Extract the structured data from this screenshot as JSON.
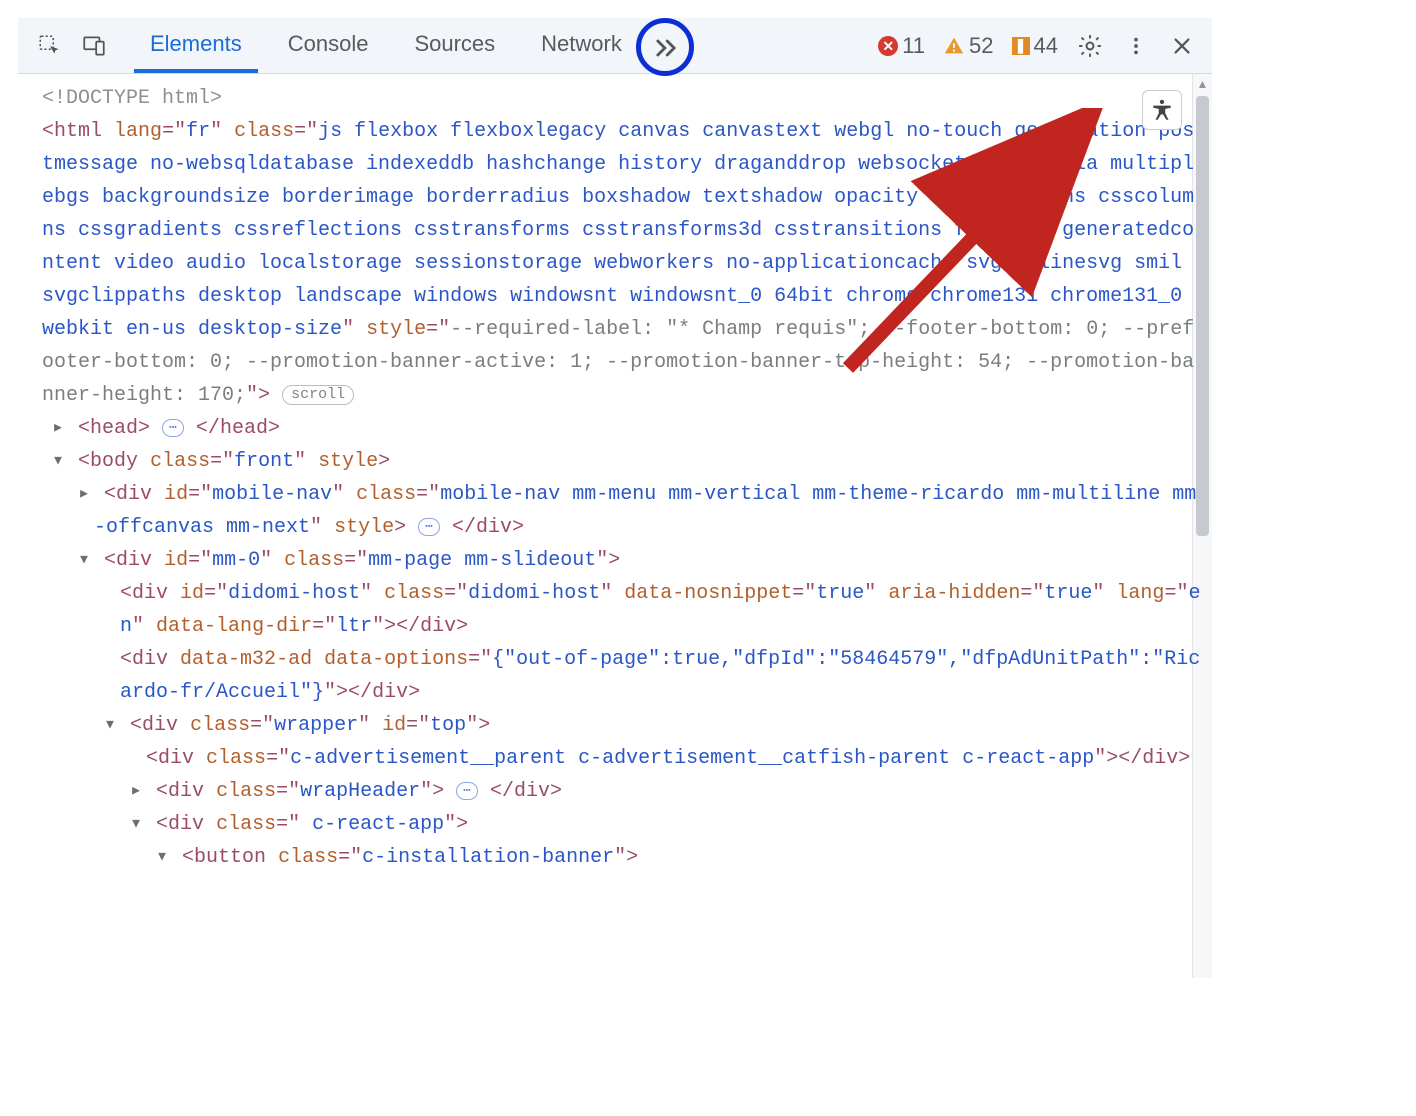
{
  "tabs": {
    "elements": "Elements",
    "console": "Console",
    "sources": "Sources",
    "network": "Network"
  },
  "issues": {
    "errors": "11",
    "warnings": "52",
    "info": "44"
  },
  "dom": {
    "doctype": "<!DOCTYPE html>",
    "html_open_1": "<html lang=\"fr\" class=\"js flexbox flexboxlegacy canvas canvastext webgl no-touch geolocation postmessage no-websqldatabase indexeddb hashchange history draganddrop websockets rgba hsla multiplebgs backgroundsize borderimage borderradius boxshadow textshadow opacity cssanimations csscolumns cssgradients cssreflections csstransforms csstransforms3d csstransitions fontface generatedcontent video audio localstorage sessionstorage webworkers no-applicationcache svg inlinesvg smil svgclippaths desktop landscape windows windowsnt windowsnt_0 64bit chrome chrome131 chrome131_0 webkit en-us desktop-size\" style=\"--required-label: \"* Champ requis\"; --footer-bottom: 0; --prefooter-bottom: 0; --promotion-banner-active: 1; --promotion-banner-top-height: 54; --promotion-banner-height: 170;\">",
    "html_lang": "fr",
    "html_class": "js flexbox flexboxlegacy canvas canvastext webgl no-touch geolocation postmessage no-websqldatabase indexeddb hashchange history draganddrop websockets rgba hsla multiplebgs backgroundsize borderimage borderradius boxshadow textshadow opacity cssanimations csscolumns cssgradients cssreflections csstransforms csstransforms3d csstransitions fontface generatedcontent video audio localstorage sessionstorage webworkers no-applicationcache svg inlinesvg smil svgclippaths desktop landscape windows windowsnt windowsnt_0 64bit chrome chrome131 chrome131_0 webkit en-us desktop-size",
    "html_style": "--required-label: \"* Champ requis\"; --footer-bottom: 0; --prefooter-bottom: 0; --promotion-banner-active: 1; --promotion-banner-top-height: 54; --promotion-banner-height: 170;",
    "scroll_badge": "scroll",
    "head_open": "<head>",
    "head_close": "</head>",
    "body_open": "<body class=\"front\" style>",
    "body_class": "front",
    "mobile_nav": "<div id=\"mobile-nav\" class=\"mobile-nav mm-menu mm-vertical mm-theme-ricardo mm-multiline mm-offcanvas mm-next\" style>",
    "mobile_nav_id": "mobile-nav",
    "mobile_nav_class": "mobile-nav mm-menu mm-vertical mm-theme-ricardo mm-multiline mm-offcanvas mm-next",
    "div_close": "</div>",
    "mm0": "<div id=\"mm-0\" class=\"mm-page mm-slideout\">",
    "mm0_id": "mm-0",
    "mm0_class": "mm-page mm-slideout",
    "didomi": "<div id=\"didomi-host\" class=\"didomi-host\" data-nosnippet=\"true\" aria-hidden=\"true\" lang=\"en\" data-lang-dir=\"ltr\"></div>",
    "didomi_id": "didomi-host",
    "didomi_class": "didomi-host",
    "didomi_nosnippet": "true",
    "didomi_hidden": "true",
    "didomi_lang": "en",
    "didomi_dir": "ltr",
    "m32ad": "<div data-m32-ad data-options=\"{\"out-of-page\":true,\"dfpId\":\"58464579\",\"dfpAdUnitPath\":\"Ricardo-fr/Accueil\"}\"></div>",
    "m32_options": "{\"out-of-page\":true,\"dfpId\":\"58464579\",\"dfpAdUnitPath\":\"Ricardo-fr/Accueil\"}",
    "wrapper": "<div class=\"wrapper\" id=\"top\">",
    "wrapper_class": "wrapper",
    "wrapper_id": "top",
    "advert": "<div class=\"c-advertisement__parent c-advertisement__catfish-parent c-react-app\"></div>",
    "advert_class": "c-advertisement__parent c-advertisement__catfish-parent c-react-app",
    "wrapHeader": "<div class=\"wrapHeader\">",
    "wrapHeader_class": "wrapHeader",
    "reactapp": "<div class=\" c-react-app\">",
    "reactapp_class": " c-react-app",
    "button": "<button class=\"c-installation-banner\">",
    "button_class": "c-installation-banner"
  }
}
